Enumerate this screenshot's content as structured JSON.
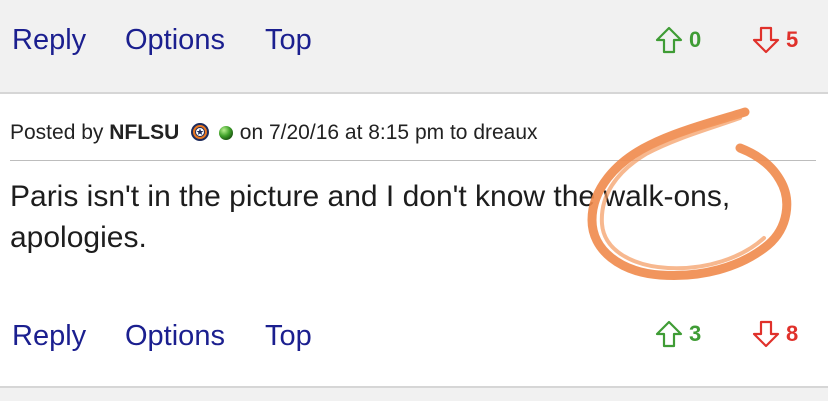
{
  "top_actions": {
    "reply": "Reply",
    "options": "Options",
    "top": "Top",
    "upvotes": "0",
    "downvotes": "5"
  },
  "post": {
    "posted_by_label": "Posted by",
    "username": "NFLSU",
    "on_label": "on",
    "datetime": "7/20/16 at 8:15 pm",
    "to_label": "to",
    "reply_to": "dreaux",
    "text": "Paris isn't in the picture and I don't know the walk-ons, apologies."
  },
  "bottom_actions": {
    "reply": "Reply",
    "options": "Options",
    "top": "Top",
    "upvotes": "3",
    "downvotes": "8"
  },
  "colors": {
    "link": "#1b1f8f",
    "upvote": "#3f9c35",
    "downvote": "#e0312b",
    "scribble": "#f08a4b"
  },
  "icons": {
    "upvote": "arrow-up-outline-icon",
    "downvote": "arrow-down-outline-icon",
    "badge": "astros-badge-icon",
    "status": "online-status-icon"
  }
}
